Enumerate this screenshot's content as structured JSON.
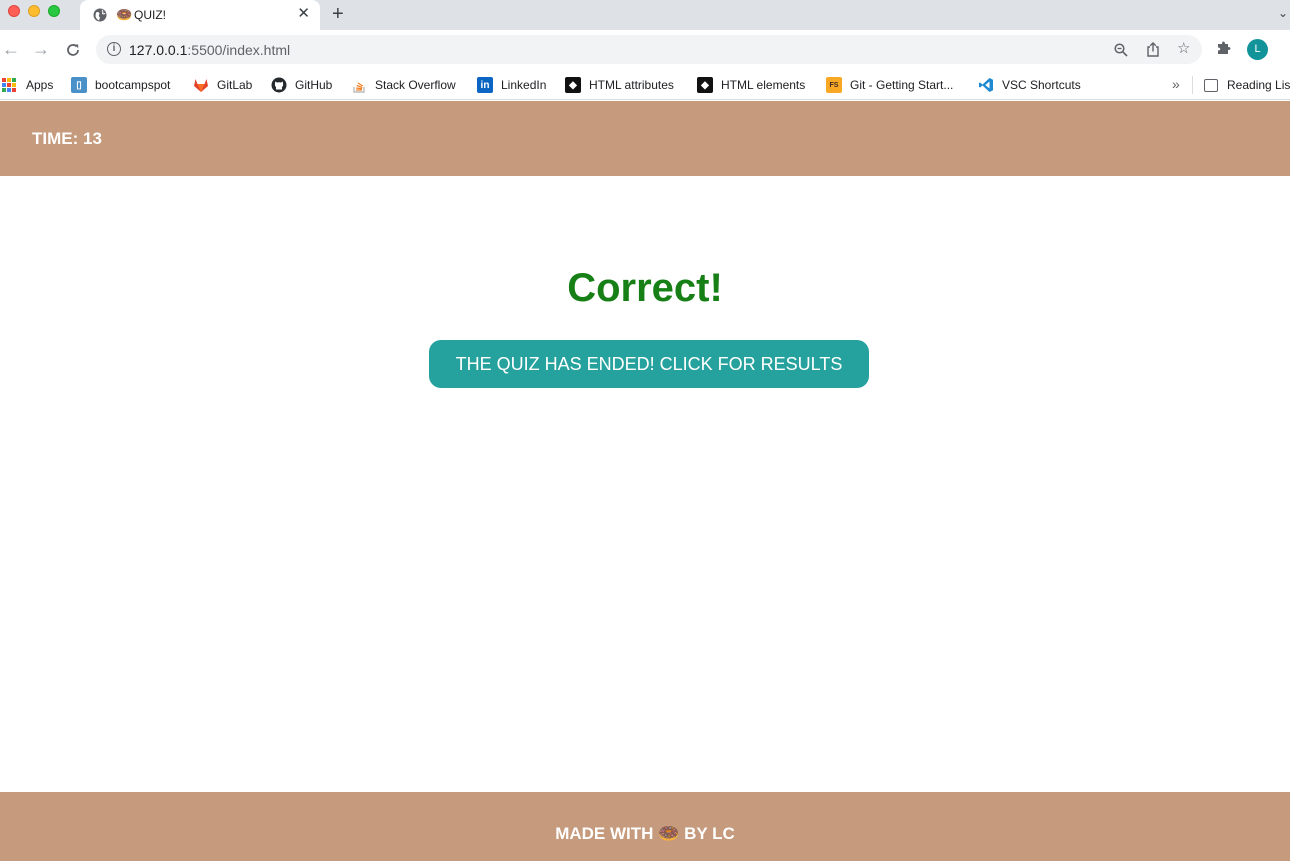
{
  "browser": {
    "tab": {
      "title": "QUIZ!",
      "favicon": "donut-emoji"
    },
    "address": {
      "host": "127.0.0.1",
      "rest": ":5500/index.html"
    },
    "profile_initial": "L",
    "bookmarks": [
      {
        "label": "Apps",
        "icon": "apps-grid-icon"
      },
      {
        "label": "bootcampspot",
        "icon": "bootcampspot-icon"
      },
      {
        "label": "GitLab",
        "icon": "gitlab-icon"
      },
      {
        "label": "GitHub",
        "icon": "github-icon"
      },
      {
        "label": "Stack Overflow",
        "icon": "stackoverflow-icon"
      },
      {
        "label": "LinkedIn",
        "icon": "linkedin-icon"
      },
      {
        "label": "HTML attributes",
        "icon": "html-attributes-icon"
      },
      {
        "label": "HTML elements",
        "icon": "html-elements-icon"
      },
      {
        "label": "Git - Getting Start...",
        "icon": "git-icon"
      },
      {
        "label": "VSC Shortcuts",
        "icon": "vscode-icon"
      }
    ],
    "reading_list": "Reading Lis"
  },
  "page": {
    "timer_text": "TIME: 13",
    "feedback_text": "Correct!",
    "results_button_label": "THE QUIZ HAS ENDED! CLICK FOR RESULTS",
    "footer_prefix": "MADE WITH",
    "footer_emoji": "🍩",
    "footer_suffix": "BY LC"
  },
  "colors": {
    "header_footer_bg": "#c69a7c",
    "feedback_correct": "#168016",
    "button_bg": "#26a29e"
  }
}
